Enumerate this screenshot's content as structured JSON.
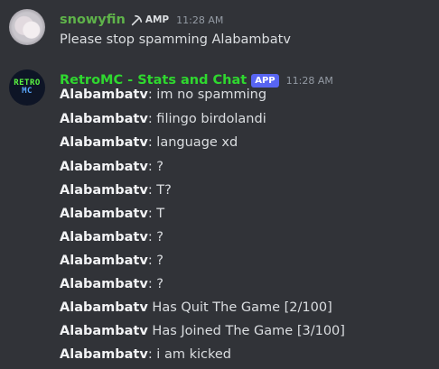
{
  "messages": [
    {
      "username": "snowyfin",
      "tag": "AMP",
      "tag_icon": "pickaxe-icon",
      "timestamp": "11:28 AM",
      "lines": [
        {
          "speaker": "",
          "text": "Please stop spamming Alabambatv"
        }
      ]
    },
    {
      "username": "RetroMC - Stats and Chat",
      "badge": "APP",
      "timestamp": "11:28 AM",
      "avatar_text": [
        "RETRO",
        "MC"
      ],
      "lines": [
        {
          "speaker": "Alabambatv",
          "text": ": im no spamming"
        },
        {
          "speaker": "Alabambatv",
          "text": ": filingo birdolandi"
        },
        {
          "speaker": "Alabambatv",
          "text": ": language xd"
        },
        {
          "speaker": "Alabambatv",
          "text": ": ?"
        },
        {
          "speaker": "Alabambatv",
          "text": ": T?"
        },
        {
          "speaker": "Alabambatv",
          "text": ": T"
        },
        {
          "speaker": "Alabambatv",
          "text": ": ?"
        },
        {
          "speaker": "Alabambatv",
          "text": ": ?"
        },
        {
          "speaker": "Alabambatv",
          "text": ": ?"
        },
        {
          "speaker": "Alabambatv",
          "text": " Has Quit The Game [2/100]"
        },
        {
          "speaker": "Alabambatv",
          "text": " Has Joined The Game [3/100]"
        },
        {
          "speaker": "Alabambatv",
          "text": ": i am kicked"
        }
      ]
    }
  ],
  "colors": {
    "background": "#313338",
    "snowyfin_name": "#5fb34a",
    "retromc_name": "#2fd82f",
    "app_badge": "#5865f2",
    "timestamp": "#949ba4"
  }
}
